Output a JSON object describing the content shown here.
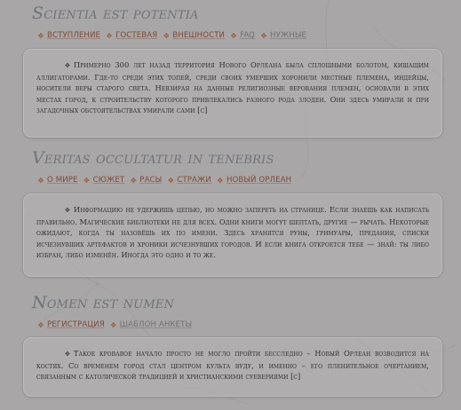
{
  "sections": [
    {
      "title": "Scientia est potentia",
      "nav": [
        {
          "label": "Вступление",
          "icon": "diamond-bullet-icon"
        },
        {
          "label": "Гостевая",
          "icon": "diamond-bullet-icon"
        },
        {
          "label": "Внешности",
          "icon": "diamond-bullet-icon"
        },
        {
          "label": "FAQ",
          "icon": "diamond-bullet-icon"
        },
        {
          "label": "Нужные",
          "icon": "diamond-bullet-icon"
        }
      ],
      "text": "Примерно 300 лет назад территория Нового Орлеана была сплошными болотом, кишащим аллигаторами. Где-то среди этих топей, среди своих умерших хоронили местные племена, индейцы, носители веры старого света. Невзирая на данные религиозные верования племен, основали в этих местах город, к строительству которого привлекались разного рода злодеи. Они здесь умирали и при загадочных обстоятельствах умирали сами [с]"
    },
    {
      "title": "Veritas occultatur in tenebris",
      "nav": [
        {
          "label": "О мире",
          "icon": "diamond-bullet-icon"
        },
        {
          "label": "Сюжет",
          "icon": "diamond-bullet-icon"
        },
        {
          "label": "Расы",
          "icon": "diamond-bullet-icon"
        },
        {
          "label": "Стражи",
          "icon": "diamond-bullet-icon"
        },
        {
          "label": "Новый Орлеан",
          "icon": "diamond-bullet-icon"
        }
      ],
      "text": "Информацию не удержишь цепью, но можно запереть на странице. Если знаешь как написать правильно. Магические библиотеки не для всех. Одни книги могут шептать, другие — рычать. Некоторые ожидают, когда ты назовёшь их по имени. Здесь хранятся руны, гримуары, предания, списки исчезнувших артефактов и хроники исчезнувших городов. И если книга откроется тебе — знай: ты либо избран, либо изменён. Иногда это одно и то же."
    },
    {
      "title": "Nomen est numen",
      "nav": [
        {
          "label": "Регистрация",
          "icon": "diamond-bullet-icon"
        },
        {
          "label": "Шаблон анкеты",
          "icon": "diamond-bullet-icon"
        }
      ],
      "text": "Такое кровавое начало просто не могло пройти бесследно – Новый Орлеан возводится на костях. Со временем город стал центром культа вуду, и именно – его пленительное очертанием, связанным с католической традицией и христианскими суевериями [с]"
    }
  ],
  "colors": {
    "background": "#a9a6a7",
    "title": "#6d7379",
    "nav_link": "#7a4a3a",
    "nav_muted": "#6e6e70",
    "body_text": "#2e2d2f",
    "box_border": "#bfbcbc"
  }
}
